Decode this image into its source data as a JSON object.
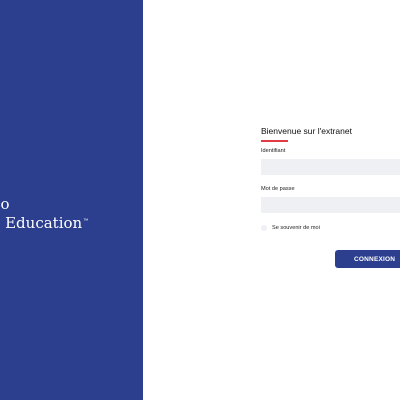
{
  "brand": {
    "logo_line1": "ileo",
    "logo_line2": "bal Education",
    "trademark": "™",
    "background_color": "#2c3f8f"
  },
  "login": {
    "title": "Bienvenue sur l'extranet",
    "accent_color": "#e03a45",
    "identifiant_label": "Identifiant",
    "identifiant_value": "",
    "password_label": "Mot de passe",
    "password_value": "",
    "remember_label": "Se souvenir de moi",
    "submit_label": "CONNEXION",
    "button_color": "#2c3f8f"
  }
}
